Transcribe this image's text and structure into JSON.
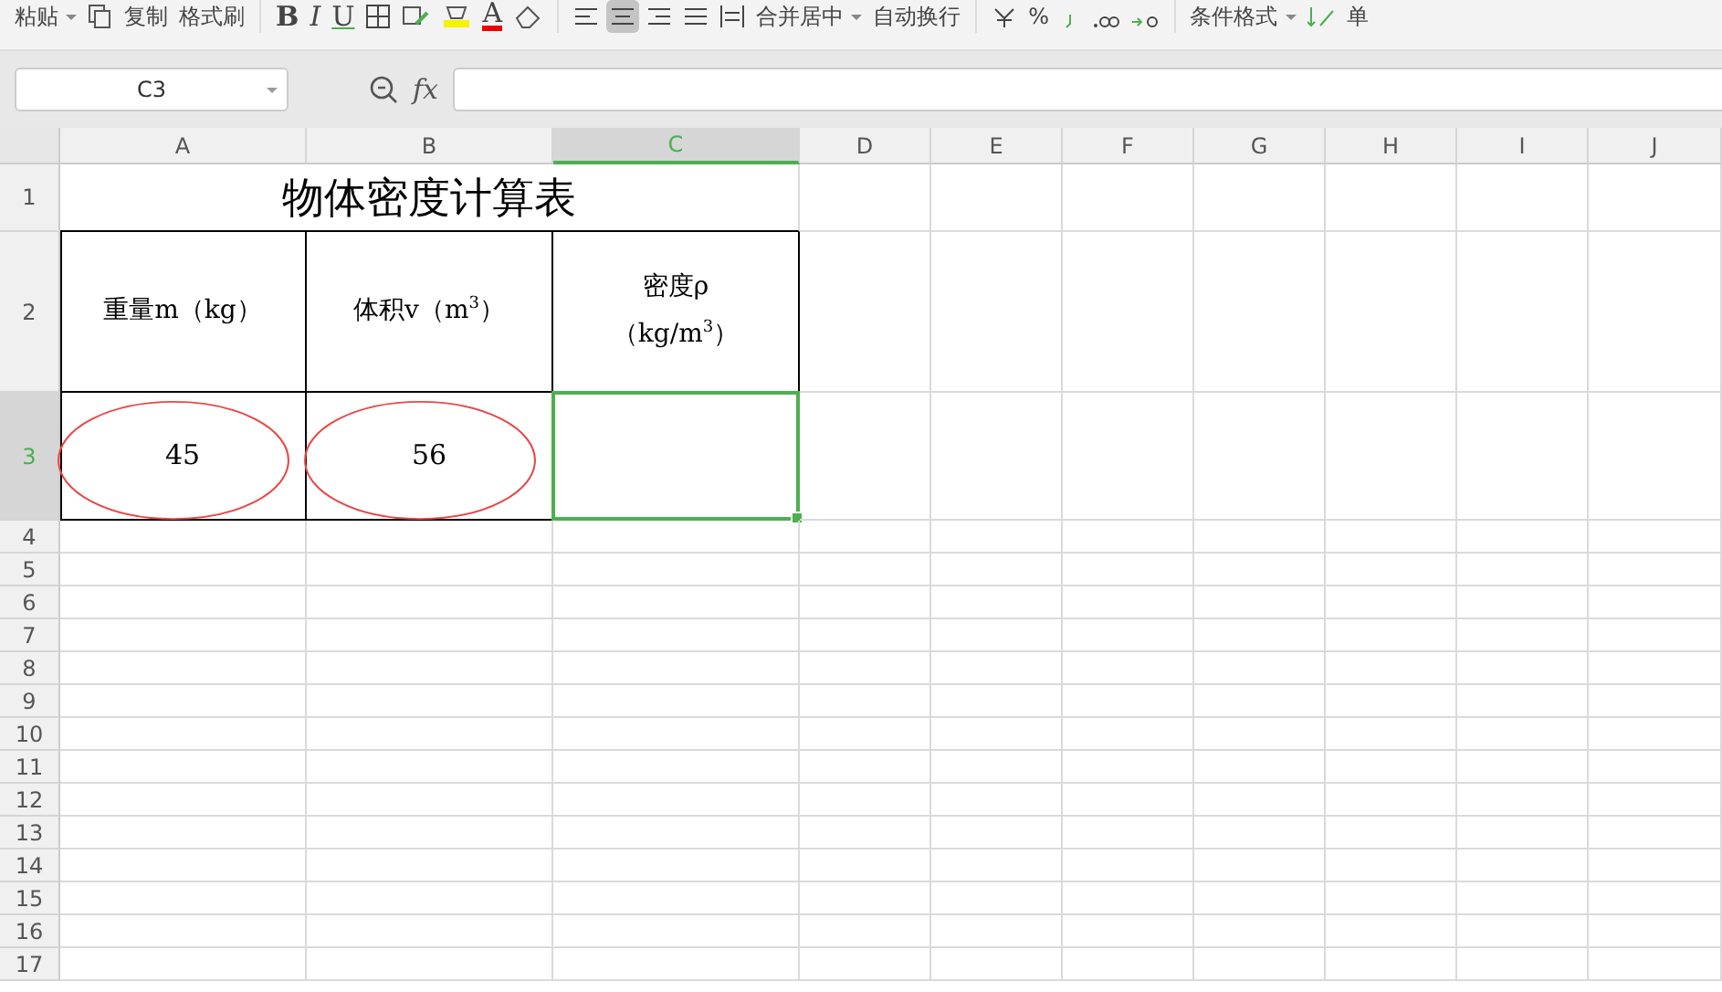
{
  "toolbar": {
    "paste": "粘贴",
    "copy": "复制",
    "format_painter": "格式刷",
    "bold": "B",
    "italic": "I",
    "underline": "U",
    "font_color": "A",
    "merge_center": "合并居中",
    "wrap_text": "自动换行",
    "percent": "%",
    "conditional_format": "条件格式",
    "cell_menu": "单"
  },
  "formula_bar": {
    "name_box": "C3",
    "fx": "fx"
  },
  "sheet": {
    "columns": [
      {
        "label": "A",
        "selected": false
      },
      {
        "label": "B",
        "selected": false
      },
      {
        "label": "C",
        "selected": true
      },
      {
        "label": "D",
        "selected": false
      },
      {
        "label": "E",
        "selected": false
      },
      {
        "label": "F",
        "selected": false
      },
      {
        "label": "G",
        "selected": false
      },
      {
        "label": "H",
        "selected": false
      },
      {
        "label": "I",
        "selected": false
      },
      {
        "label": "J",
        "selected": false
      }
    ],
    "rows": [
      {
        "label": "1",
        "selected": false
      },
      {
        "label": "2",
        "selected": false
      },
      {
        "label": "3",
        "selected": true
      },
      {
        "label": "4",
        "selected": false
      },
      {
        "label": "5",
        "selected": false
      },
      {
        "label": "6",
        "selected": false
      },
      {
        "label": "7",
        "selected": false
      },
      {
        "label": "8",
        "selected": false
      },
      {
        "label": "9",
        "selected": false
      },
      {
        "label": "10",
        "selected": false
      },
      {
        "label": "11",
        "selected": false
      },
      {
        "label": "12",
        "selected": false
      },
      {
        "label": "13",
        "selected": false
      },
      {
        "label": "14",
        "selected": false
      },
      {
        "label": "15",
        "selected": false
      },
      {
        "label": "16",
        "selected": false
      },
      {
        "label": "17",
        "selected": false
      }
    ],
    "title": "物体密度计算表",
    "headers": [
      [
        "重量m（kg）"
      ],
      [
        "体积v（m$^{3}$）"
      ],
      [
        "密度ρ",
        "（kg/m$^{3}$）"
      ]
    ],
    "values": [
      {
        "text": "45",
        "circled": true
      },
      {
        "text": "56",
        "circled": true
      },
      {
        "circled": false
      }
    ]
  }
}
